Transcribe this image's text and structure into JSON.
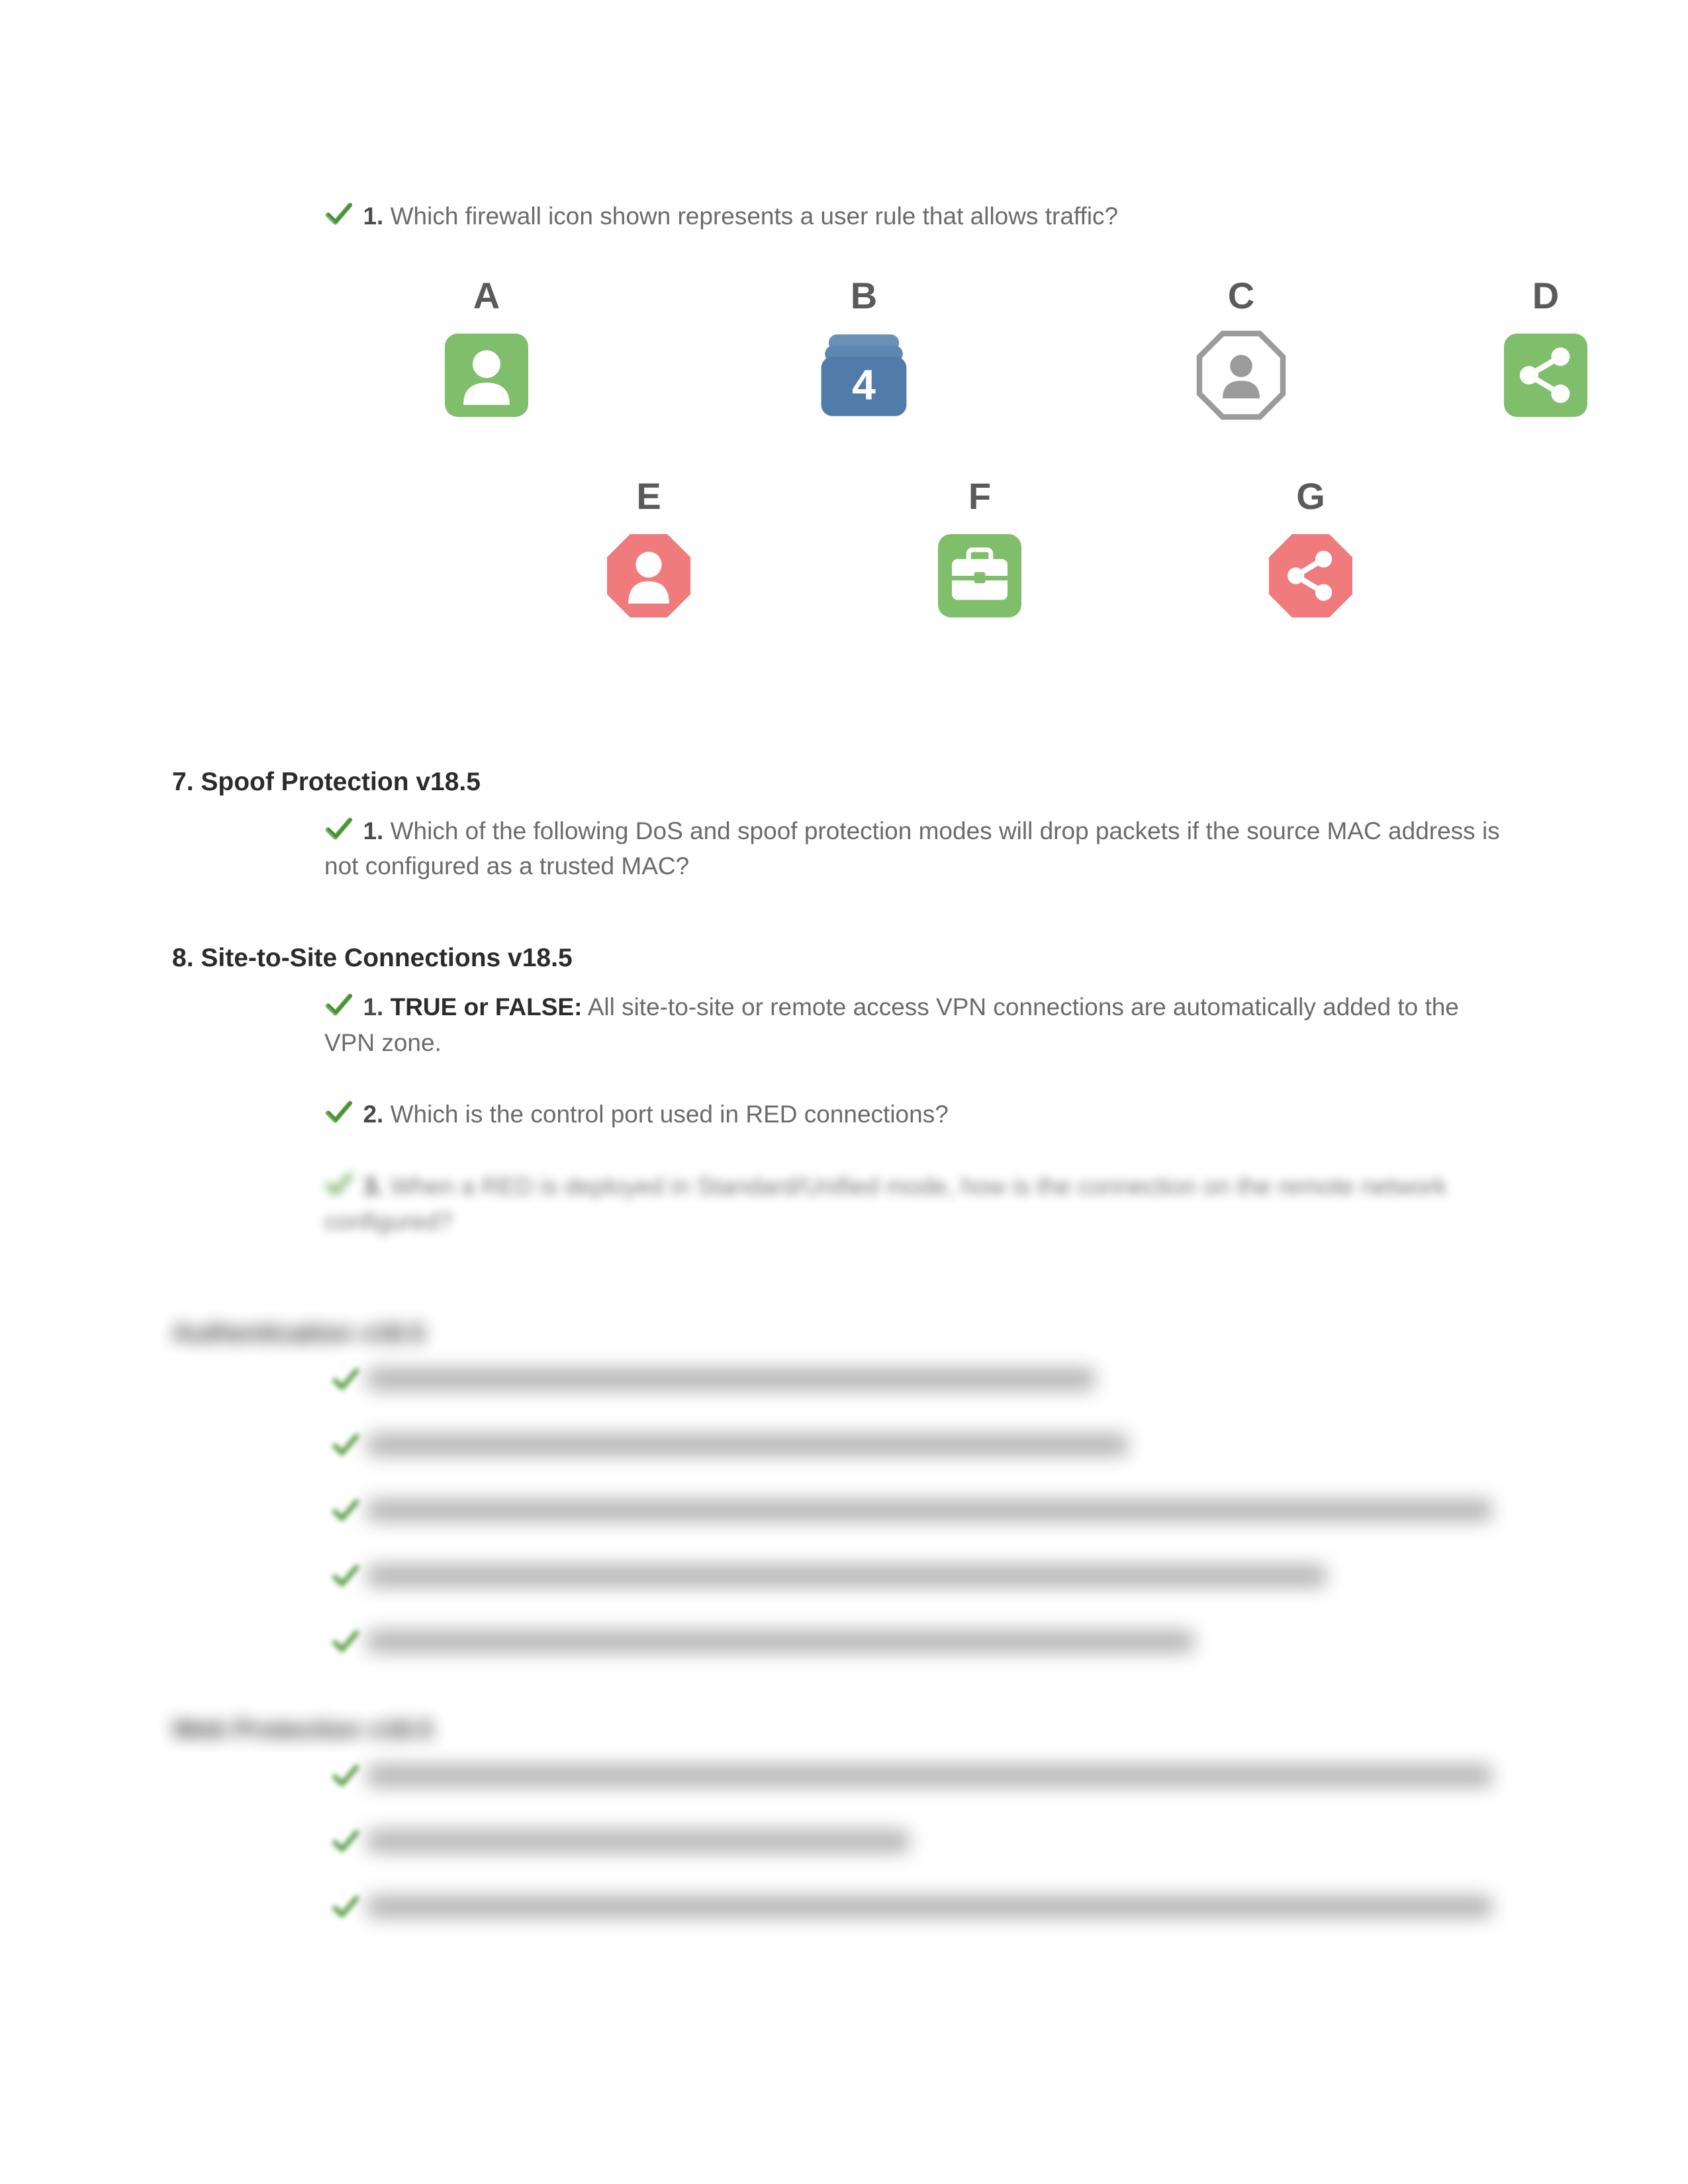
{
  "q_firewall": {
    "number": "1.",
    "text": "Which firewall icon shown represents a user rule that allows traffic?"
  },
  "icons": {
    "row1": [
      {
        "label": "A",
        "type": "user-green"
      },
      {
        "label": "B",
        "type": "stack-blue",
        "num": "4"
      },
      {
        "label": "C",
        "type": "user-outline-octagon"
      },
      {
        "label": "D",
        "type": "share-green"
      }
    ],
    "row2": [
      {
        "label": "E",
        "type": "user-red-octagon"
      },
      {
        "label": "F",
        "type": "briefcase-green"
      },
      {
        "label": "G",
        "type": "share-red-octagon"
      }
    ]
  },
  "sections": [
    {
      "num": "7.",
      "title": "Spoof Protection v18.5",
      "questions": [
        {
          "num": "1.",
          "bold": "",
          "text": "Which of the following DoS and spoof protection modes will drop packets if the source MAC address is not configured as a trusted MAC?"
        }
      ]
    },
    {
      "num": "8.",
      "title": "Site-to-Site Connections  v18.5",
      "questions": [
        {
          "num": "1.",
          "bold": "TRUE or FALSE:",
          "text": " All site-to-site or remote access VPN connections are automatically added to the VPN zone."
        },
        {
          "num": "2.",
          "bold": "",
          "text": "Which is the control port used in RED connections?"
        },
        {
          "num": "3.",
          "bold": "",
          "text": "When a RED is deployed in Standard/Unified mode, how is the connection on the remote network configured?",
          "blur": "blur1"
        }
      ]
    }
  ],
  "blurred_sections": [
    {
      "title": "Authentication v18.5",
      "lines": [
        1100,
        1150,
        1700,
        1450,
        1250
      ]
    },
    {
      "title": "Web Protection v18.5",
      "lines": [
        1700,
        820,
        1700
      ]
    }
  ]
}
